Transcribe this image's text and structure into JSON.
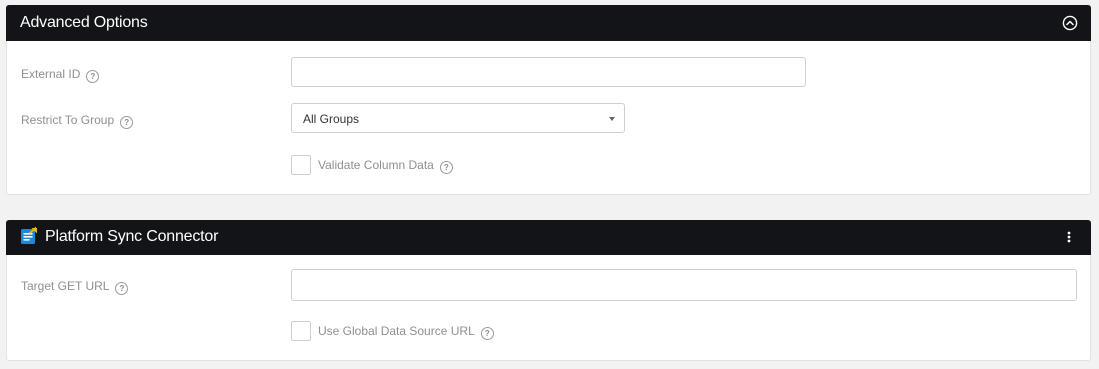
{
  "advanced": {
    "title": "Advanced Options",
    "collapse_icon": "chevron-up-circle-icon",
    "external_id": {
      "label": "External ID",
      "value": "",
      "placeholder": ""
    },
    "restrict_group": {
      "label": "Restrict To Group",
      "selected": "All Groups"
    },
    "validate": {
      "label": "Validate Column Data",
      "checked": false
    }
  },
  "connector": {
    "title": "Platform Sync Connector",
    "icon": "connector-document-icon",
    "menu_icon": "kebab-menu-icon",
    "target_url": {
      "label": "Target GET URL",
      "value": "",
      "placeholder": ""
    },
    "global_source": {
      "label": "Use Global Data Source URL",
      "checked": false
    }
  },
  "help_glyph": "?"
}
